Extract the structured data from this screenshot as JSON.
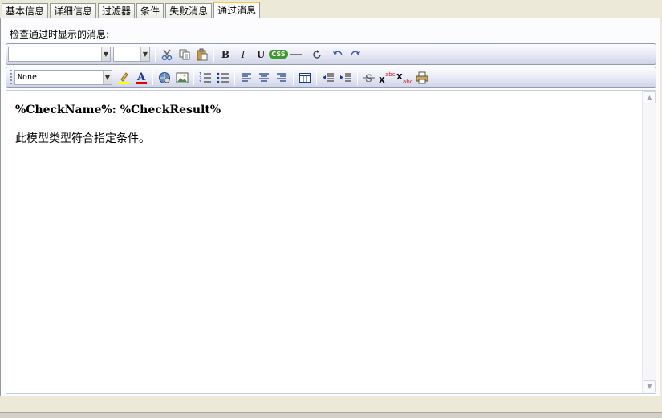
{
  "tabs": [
    {
      "label": "基本信息",
      "active": false
    },
    {
      "label": "详细信息",
      "active": false
    },
    {
      "label": "过滤器",
      "active": false
    },
    {
      "label": "条件",
      "active": false
    },
    {
      "label": "失败消息",
      "active": false
    },
    {
      "label": "通过消息",
      "active": true
    }
  ],
  "panel": {
    "caption": "检查通过时显示的消息:"
  },
  "toolbar1": {
    "font_family_value": "",
    "font_size_value": "",
    "css_label": "CSS",
    "bold_label": "B",
    "italic_label": "I",
    "underline_label": "U"
  },
  "toolbar2": {
    "style_value": "None"
  },
  "editor": {
    "heading": "%CheckName%: %CheckResult%",
    "body": "此模型类型符合指定条件。"
  },
  "colors": {
    "active_tab_accent": "#ffc83c",
    "toolbar_border": "#8f9cb8",
    "highlight_color": "#ffff00",
    "font_color": "#e00000",
    "css_badge": "#3a9a2a"
  }
}
